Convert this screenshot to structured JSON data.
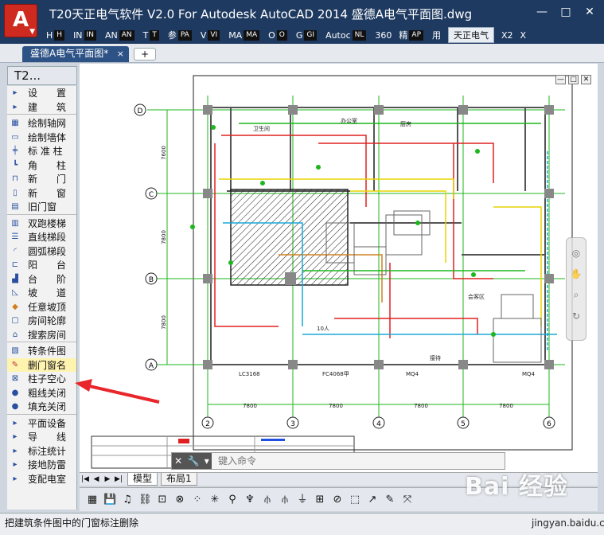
{
  "window": {
    "title": "T20天正电气软件 V2.0 For Autodesk AutoCAD 2014     盛德A电气平面图.dwg",
    "app_button": "A",
    "controls": [
      "—",
      "□",
      "✕"
    ]
  },
  "ribbon_tabs": [
    {
      "label": "H",
      "key": "H"
    },
    {
      "label": "IN",
      "key": "IN"
    },
    {
      "label": "AN",
      "key": "AN"
    },
    {
      "label": "T",
      "key": "T"
    },
    {
      "label": "参",
      "key": "PA"
    },
    {
      "label": "V",
      "key": "VI"
    },
    {
      "label": "MA",
      "key": "MA"
    },
    {
      "label": "O",
      "key": "O"
    },
    {
      "label": "G",
      "key": "GI"
    },
    {
      "label": "Autoc",
      "key": "NL"
    },
    {
      "label": "360",
      "key": ""
    },
    {
      "label": "精",
      "key": "AP"
    },
    {
      "label": "用",
      "key": ""
    },
    {
      "label": "天正电气",
      "key": "",
      "active": true
    },
    {
      "label": "X2",
      "key": ""
    },
    {
      "label": "X",
      "key": ""
    }
  ],
  "document_tab": {
    "label": "盛德A电气平面图*",
    "close": "×",
    "new": "+"
  },
  "palette": {
    "title": "T2...",
    "items": [
      {
        "label": "设　　置",
        "icon": "triangle-icon"
      },
      {
        "label": "建　　筑",
        "icon": "triangle-icon"
      },
      {
        "sep": true
      },
      {
        "label": "绘制轴网",
        "icon": "grid-icon"
      },
      {
        "label": "绘制墙体",
        "icon": "wall-icon"
      },
      {
        "label": "标 准 柱",
        "icon": "column-icon"
      },
      {
        "label": "角　　柱",
        "icon": "corner-column-icon"
      },
      {
        "label": "新　　门",
        "icon": "door-icon"
      },
      {
        "label": "新　　窗",
        "icon": "window-icon"
      },
      {
        "label": "旧门窗",
        "icon": "old-window-icon"
      },
      {
        "sep": true
      },
      {
        "label": "双跑楼梯",
        "icon": "stair-icon"
      },
      {
        "label": "直线梯段",
        "icon": "straight-stair-icon"
      },
      {
        "label": "圆弧梯段",
        "icon": "arc-stair-icon"
      },
      {
        "label": "阳　　台",
        "icon": "balcony-icon"
      },
      {
        "label": "台　　阶",
        "icon": "step-icon"
      },
      {
        "label": "坡　　道",
        "icon": "ramp-icon"
      },
      {
        "label": "任意坡顶",
        "icon": "roof-icon"
      },
      {
        "label": "房间轮廓",
        "icon": "room-outline-icon"
      },
      {
        "label": "搜索房间",
        "icon": "search-room-icon"
      },
      {
        "sep": true
      },
      {
        "label": "转条件图",
        "icon": "convert-icon"
      },
      {
        "label": "删门窗名",
        "icon": "delete-name-icon",
        "highlight": true
      },
      {
        "label": "柱子空心",
        "icon": "hollow-column-icon"
      },
      {
        "label": "粗线关闭",
        "icon": "bulb-icon"
      },
      {
        "label": "填充关闭",
        "icon": "bulb-icon"
      },
      {
        "sep": true
      },
      {
        "label": "平面设备",
        "icon": "triangle-icon"
      },
      {
        "label": "导　　线",
        "icon": "triangle-icon"
      },
      {
        "label": "标注统计",
        "icon": "triangle-icon"
      },
      {
        "label": "接地防雷",
        "icon": "triangle-icon"
      },
      {
        "label": "变配电室",
        "icon": "triangle-icon"
      }
    ]
  },
  "drawing": {
    "axes_rows": [
      "D",
      "C",
      "B",
      "A"
    ],
    "axes_cols": [
      "2",
      "3",
      "4",
      "5",
      "6"
    ],
    "row_dims": [
      "7600",
      "7800",
      "7800"
    ],
    "col_dims": [
      "7800",
      "7800",
      "7800",
      "7800"
    ],
    "labels": [
      {
        "text": "LC3168"
      },
      {
        "text": "FC4068甲"
      },
      {
        "text": "MQ4"
      },
      {
        "text": "MQ4"
      },
      {
        "text": "卫生间"
      },
      {
        "text": "办公室"
      },
      {
        "text": "厨房"
      },
      {
        "text": "会客区"
      },
      {
        "text": "10人"
      },
      {
        "text": "接待"
      }
    ]
  },
  "viewport_controls": [
    "—",
    "□",
    "✕"
  ],
  "command_line": {
    "placeholder": "键入命令"
  },
  "layout_tabs": {
    "nav": [
      "|◀",
      "◀",
      "▶",
      "▶|"
    ],
    "tabs": [
      {
        "label": "模型",
        "active": true
      },
      {
        "label": "布局1",
        "active": false
      }
    ]
  },
  "toolbar_icons": [
    "layers-icon",
    "save-icon",
    "audio-icon",
    "link-icon",
    "snap-icon",
    "circle-icon",
    "dots-icon",
    "light-icon",
    "pin-icon",
    "lamp-icon",
    "ceiling-icon",
    "ceiling-icon",
    "switch-icon",
    "grid2-icon",
    "magnify-icon",
    "select-icon",
    "arrow-icon",
    "edit-icon",
    "move-icon"
  ],
  "status_text": "把建筑条件图中的门窗标注删除",
  "watermark": {
    "brand": "Bai 经验",
    "url": "jingyan.baidu.com"
  },
  "colors": {
    "accent": "#2d5285",
    "title": "#1f3a60",
    "arrow": "#e8262c"
  }
}
